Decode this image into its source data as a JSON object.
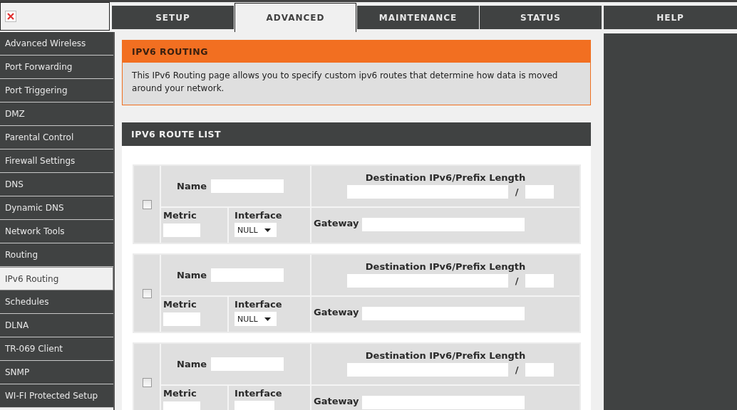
{
  "tabs": [
    {
      "label": "SETUP",
      "selected": false
    },
    {
      "label": "ADVANCED",
      "selected": true
    },
    {
      "label": "MAINTENANCE",
      "selected": false
    },
    {
      "label": "STATUS",
      "selected": false
    },
    {
      "label": "HELP",
      "selected": false
    }
  ],
  "sidebar": {
    "items": [
      {
        "label": "Advanced Wireless",
        "selected": false
      },
      {
        "label": "Port Forwarding",
        "selected": false
      },
      {
        "label": "Port Triggering",
        "selected": false
      },
      {
        "label": "DMZ",
        "selected": false
      },
      {
        "label": "Parental Control",
        "selected": false
      },
      {
        "label": "Firewall Settings",
        "selected": false
      },
      {
        "label": "DNS",
        "selected": false
      },
      {
        "label": "Dynamic DNS",
        "selected": false
      },
      {
        "label": "Network Tools",
        "selected": false
      },
      {
        "label": "Routing",
        "selected": false
      },
      {
        "label": "IPv6 Routing",
        "selected": true
      },
      {
        "label": "Schedules",
        "selected": false
      },
      {
        "label": "DLNA",
        "selected": false
      },
      {
        "label": "TR-069 Client",
        "selected": false
      },
      {
        "label": "SNMP",
        "selected": false
      },
      {
        "label": "WI-FI Protected Setup",
        "selected": false
      }
    ]
  },
  "intro": {
    "title": "IPV6 ROUTING",
    "description": "This IPv6 Routing page allows you to specify custom ipv6 routes that determine how data is moved around your network."
  },
  "route_list": {
    "title": "IPV6 ROUTE LIST",
    "routes": [
      {
        "checked": false,
        "name_label": "Name",
        "destination_label": "Destination IPv6/Prefix Length",
        "separator": "/",
        "metric_label": "Metric",
        "interface_label": "Interface",
        "interface": "NULL",
        "gateway_label": "Gateway"
      },
      {
        "checked": false,
        "name_label": "Name",
        "destination_label": "Destination IPv6/Prefix Length",
        "separator": "/",
        "metric_label": "Metric",
        "interface_label": "Interface",
        "interface": "NULL",
        "gateway_label": "Gateway"
      },
      {
        "checked": false,
        "name_label": "Name",
        "destination_label": "Destination IPv6/Prefix Length",
        "separator": "/",
        "metric_label": "Metric",
        "interface_label": "Interface",
        "gateway_label": "Gateway"
      }
    ]
  }
}
